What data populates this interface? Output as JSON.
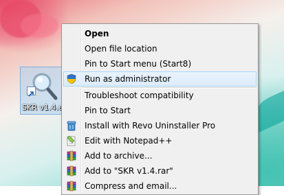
{
  "desktop_icon": {
    "label": "SKR v1.4.e",
    "icon": "magnifier-shortcut-icon"
  },
  "context_menu": {
    "items": [
      {
        "label": "Open",
        "bold": true
      },
      {
        "label": "Open file location"
      },
      {
        "label": "Pin to Start menu (Start8)"
      },
      {
        "label": "Run as administrator",
        "icon": "uac-shield-icon",
        "highlighted": true
      },
      {
        "label": "Troubleshoot compatibility"
      },
      {
        "label": "Pin to Start"
      },
      {
        "label": "Install with Revo Uninstaller Pro",
        "icon": "revo-uninstaller-icon"
      },
      {
        "label": "Edit with Notepad++",
        "icon": "notepad-plus-plus-icon"
      },
      {
        "label": "Add to archive...",
        "icon": "winrar-icon"
      },
      {
        "label": "Add to \"SKR v1.4.rar\"",
        "icon": "winrar-icon"
      },
      {
        "label": "Compress and email...",
        "icon": "winrar-icon"
      }
    ]
  },
  "colors": {
    "menu_background": "#f0f0f0",
    "highlight_background": "#dcebfc",
    "highlight_border": "#a8d8f7"
  }
}
